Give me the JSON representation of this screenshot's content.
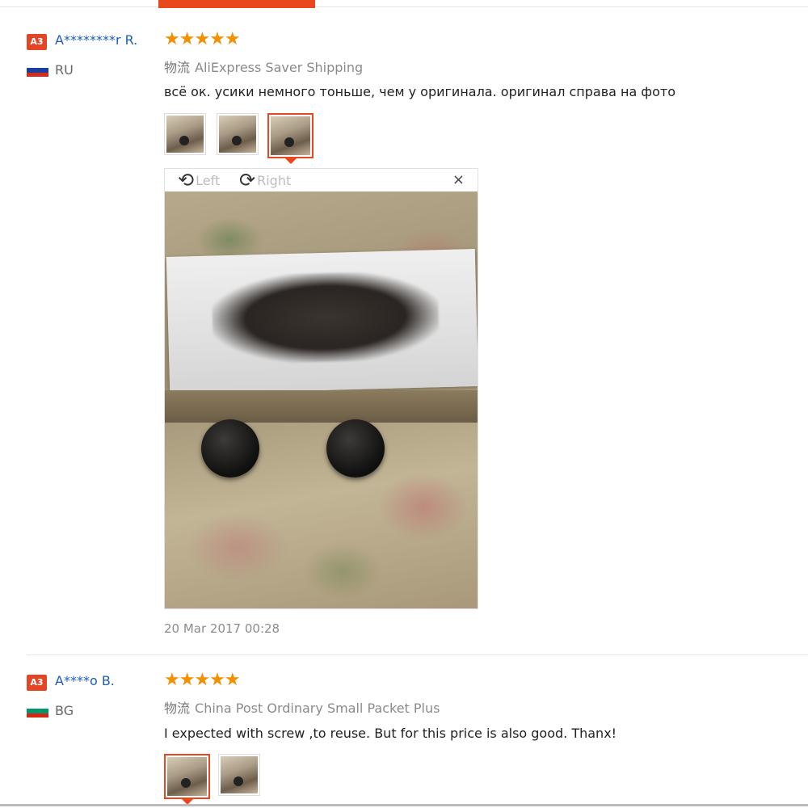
{
  "reviews": [
    {
      "avatar": "A3",
      "user": "A********r R.",
      "country": "RU",
      "flag_colors": [
        "#ffffff",
        "#1c3f9e",
        "#d52b1e"
      ],
      "stars": "★★★★★",
      "shipping_label": "物流",
      "shipping_method": "AliExpress Saver Shipping",
      "feedback": "всё ок. усики немного тоньше, чем у оригинала. оригинал справа на фото",
      "viewer": {
        "rotate_left": "Left",
        "rotate_right": "Right",
        "close": "×"
      },
      "date": "20 Mar 2017 00:28"
    },
    {
      "avatar": "A3",
      "user": "A****o B.",
      "country": "BG",
      "flag_colors": [
        "#ffffff",
        "#00966e",
        "#d62612"
      ],
      "stars": "★★★★★",
      "shipping_label": "物流",
      "shipping_method": "China Post Ordinary Small Packet Plus",
      "feedback": "I expected with screw ,to reuse. But for this price is also good. Thanx!"
    }
  ],
  "colors": {
    "accent": "#e8481c",
    "star": "#f39000",
    "user_link": "#1d5db8"
  }
}
